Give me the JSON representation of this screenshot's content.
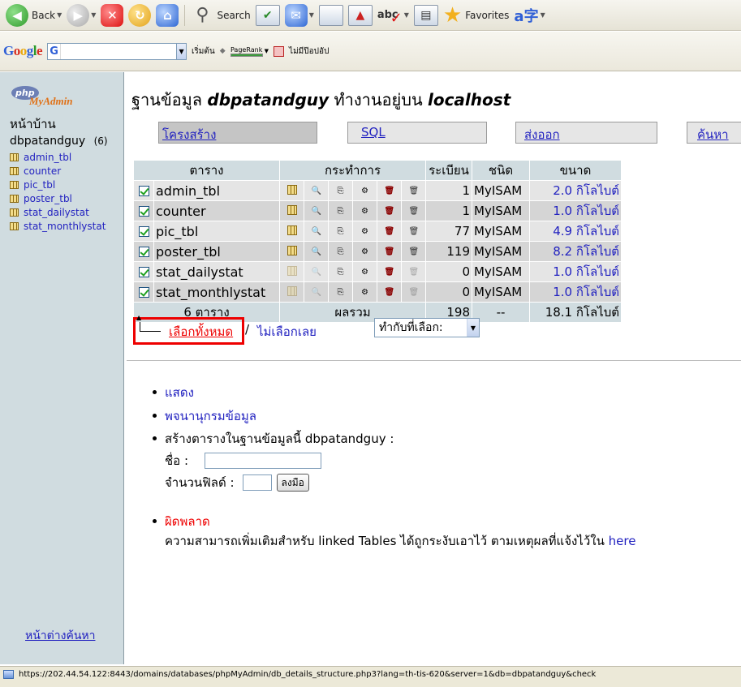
{
  "browser_toolbar": {
    "back_label": "Back",
    "search_label": "Search",
    "favorites_label": "Favorites",
    "spell_label": "abc"
  },
  "google_toolbar": {
    "logo": [
      "G",
      "o",
      "o",
      "g",
      "l",
      "e"
    ],
    "search_badge": "G",
    "search_value": "",
    "start_label": "เริ่มต้น",
    "pagerank_label": "PageRank",
    "popup_label": "ไม่มีป๊อปอัป"
  },
  "sidebar": {
    "logo_php": "php",
    "logo_admin": "MyAdmin",
    "home": "หน้าบ้าน",
    "database": "dbpatandguy",
    "table_count": "(6)",
    "tables": [
      "admin_tbl",
      "counter",
      "pic_tbl",
      "poster_tbl",
      "stat_dailystat",
      "stat_monthlystat"
    ],
    "query_window": "หน้าต่างค้นหา"
  },
  "main": {
    "title_prefix": "ฐานข้อมูล",
    "title_db": "dbpatandguy",
    "title_mid": "ทำงานอยู่บน",
    "title_host": "localhost",
    "tabs": [
      "โครงสร้าง",
      "SQL",
      "ส่งออก",
      "ค้นหา"
    ],
    "table_headers": {
      "table": "ตาราง",
      "action": "กระทำการ",
      "records": "ระเบียน",
      "type": "ชนิด",
      "size": "ขนาด"
    },
    "rows": [
      {
        "name": "admin_tbl",
        "records": "1",
        "type": "MyISAM",
        "size": "2.0 กิโลไบต์",
        "empty": false
      },
      {
        "name": "counter",
        "records": "1",
        "type": "MyISAM",
        "size": "1.0 กิโลไบต์",
        "empty": false
      },
      {
        "name": "pic_tbl",
        "records": "77",
        "type": "MyISAM",
        "size": "4.9 กิโลไบต์",
        "empty": false
      },
      {
        "name": "poster_tbl",
        "records": "119",
        "type": "MyISAM",
        "size": "8.2 กิโลไบต์",
        "empty": false
      },
      {
        "name": "stat_dailystat",
        "records": "0",
        "type": "MyISAM",
        "size": "1.0 กิโลไบต์",
        "empty": true
      },
      {
        "name": "stat_monthlystat",
        "records": "0",
        "type": "MyISAM",
        "size": "1.0 กิโลไบต์",
        "empty": true
      }
    ],
    "footer": {
      "tables": "6 ตาราง",
      "sum_label": "ผลรวม",
      "records": "198",
      "type": "--",
      "size": "18.1 กิโลไบต์"
    },
    "check_all": "เลือกทั้งหมด",
    "check_sep": "/",
    "uncheck_all": "ไม่เลือกเลย",
    "with_selected": "ทำกับที่เลือก:",
    "links": {
      "show": "แสดง",
      "dictionary": "พจนานุกรมข้อมูล",
      "create_label": "สร้างตารางในฐานข้อมูลนี้ dbpatandguy :",
      "name_label": "ชื่อ :",
      "fields_label": "จำนวนฟิลด์ :",
      "go_button": "ลงมือ",
      "error_title": "ผิดพลาด",
      "error_msg_pre": "ความสามารถเพิ่มเติมสำหรับ linked Tables ได้ถูกระงับเอาไว้ ตามเหตุผลที่แจ้งไว้ใน ",
      "error_link": "here"
    }
  },
  "statusbar": {
    "url": "https://202.44.54.122:8443/domains/databases/phpMyAdmin/db_details_structure.php3?lang=th-tis-620&server=1&db=dbpatandguy&check"
  }
}
